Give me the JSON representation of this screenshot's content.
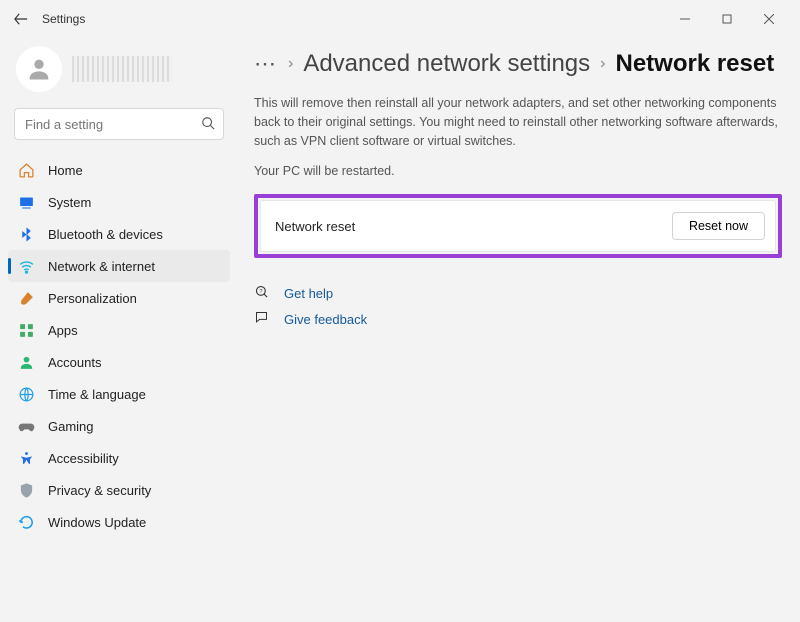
{
  "window": {
    "title": "Settings"
  },
  "search": {
    "placeholder": "Find a setting"
  },
  "nav": {
    "items": [
      {
        "label": "Home"
      },
      {
        "label": "System"
      },
      {
        "label": "Bluetooth & devices"
      },
      {
        "label": "Network & internet"
      },
      {
        "label": "Personalization"
      },
      {
        "label": "Apps"
      },
      {
        "label": "Accounts"
      },
      {
        "label": "Time & language"
      },
      {
        "label": "Gaming"
      },
      {
        "label": "Accessibility"
      },
      {
        "label": "Privacy & security"
      },
      {
        "label": "Windows Update"
      }
    ]
  },
  "breadcrumb": {
    "parent": "Advanced network settings",
    "current": "Network reset"
  },
  "page": {
    "description1": "This will remove then reinstall all your network adapters, and set other networking components back to their original settings. You might need to reinstall other networking software afterwards, such as VPN client software or virtual switches.",
    "description2": "Your PC will be restarted.",
    "reset_label": "Network reset",
    "reset_button": "Reset now",
    "help_label": "Get help",
    "feedback_label": "Give feedback"
  }
}
